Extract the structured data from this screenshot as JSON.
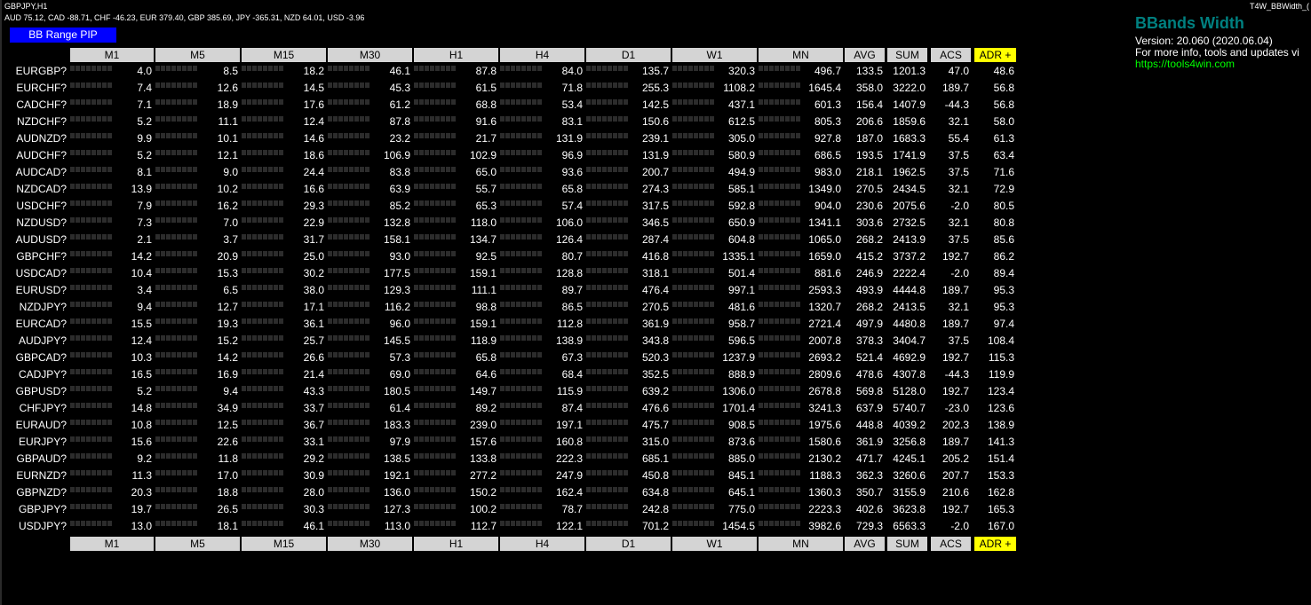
{
  "window": {
    "chart_title": "GBPJPY,H1",
    "currency_strength": "AUD 75.12, CAD -88.71, CHF -46.23, EUR 379.40, GBP 385.69, JPY -365.31, NZD 64.01, USD -3.96",
    "indicator_name": "T4W_BBWidth_(",
    "mode_button": "BB Range PIP"
  },
  "brand": {
    "title": "BBands Width",
    "version": "Version: 20.060 (2020.06.04)",
    "info": "For more info, tools and updates vi",
    "link": "https://tools4win.com"
  },
  "colors": {
    "background": "#000000",
    "header_bg": "#d4d4d4",
    "adr_header_bg": "#ffff00",
    "mode_button_bg": "#0000ff",
    "brand_title": "#008080",
    "link": "#00ff00",
    "bar_empty": "#2c2c2c"
  },
  "table": {
    "columns": [
      "M1",
      "M5",
      "M15",
      "M30",
      "H1",
      "H4",
      "D1",
      "W1",
      "MN",
      "AVG",
      "SUM",
      "ACS",
      "ADR +"
    ],
    "rows": [
      {
        "symbol": "EURGBP?",
        "values": [
          "4.0",
          "8.5",
          "18.2",
          "46.1",
          "87.8",
          "84.0",
          "135.7",
          "320.3",
          "496.7",
          "133.5",
          "1201.3",
          "47.0",
          "48.6"
        ]
      },
      {
        "symbol": "EURCHF?",
        "values": [
          "7.4",
          "12.6",
          "14.5",
          "45.3",
          "61.5",
          "71.8",
          "255.3",
          "1108.2",
          "1645.4",
          "358.0",
          "3222.0",
          "189.7",
          "56.8"
        ]
      },
      {
        "symbol": "CADCHF?",
        "values": [
          "7.1",
          "18.9",
          "17.6",
          "61.2",
          "68.8",
          "53.4",
          "142.5",
          "437.1",
          "601.3",
          "156.4",
          "1407.9",
          "-44.3",
          "56.8"
        ]
      },
      {
        "symbol": "NZDCHF?",
        "values": [
          "5.2",
          "11.1",
          "12.4",
          "87.8",
          "91.6",
          "83.1",
          "150.6",
          "612.5",
          "805.3",
          "206.6",
          "1859.6",
          "32.1",
          "58.0"
        ]
      },
      {
        "symbol": "AUDNZD?",
        "values": [
          "9.9",
          "10.1",
          "14.6",
          "23.2",
          "21.7",
          "131.9",
          "239.1",
          "305.0",
          "927.8",
          "187.0",
          "1683.3",
          "55.4",
          "61.3"
        ]
      },
      {
        "symbol": "AUDCHF?",
        "values": [
          "5.2",
          "12.1",
          "18.6",
          "106.9",
          "102.9",
          "96.9",
          "131.9",
          "580.9",
          "686.5",
          "193.5",
          "1741.9",
          "37.5",
          "63.4"
        ]
      },
      {
        "symbol": "AUDCAD?",
        "values": [
          "8.1",
          "9.0",
          "24.4",
          "83.8",
          "65.0",
          "93.6",
          "200.7",
          "494.9",
          "983.0",
          "218.1",
          "1962.5",
          "37.5",
          "71.6"
        ]
      },
      {
        "symbol": "NZDCAD?",
        "values": [
          "13.9",
          "10.2",
          "16.6",
          "63.9",
          "55.7",
          "65.8",
          "274.3",
          "585.1",
          "1349.0",
          "270.5",
          "2434.5",
          "32.1",
          "72.9"
        ]
      },
      {
        "symbol": "USDCHF?",
        "values": [
          "7.9",
          "16.2",
          "29.3",
          "85.2",
          "65.3",
          "57.4",
          "317.5",
          "592.8",
          "904.0",
          "230.6",
          "2075.6",
          "-2.0",
          "80.5"
        ]
      },
      {
        "symbol": "NZDUSD?",
        "values": [
          "7.3",
          "7.0",
          "22.9",
          "132.8",
          "118.0",
          "106.0",
          "346.5",
          "650.9",
          "1341.1",
          "303.6",
          "2732.5",
          "32.1",
          "80.8"
        ]
      },
      {
        "symbol": "AUDUSD?",
        "values": [
          "2.1",
          "3.7",
          "31.7",
          "158.1",
          "134.7",
          "126.4",
          "287.4",
          "604.8",
          "1065.0",
          "268.2",
          "2413.9",
          "37.5",
          "85.6"
        ]
      },
      {
        "symbol": "GBPCHF?",
        "values": [
          "14.2",
          "20.9",
          "25.0",
          "93.0",
          "92.5",
          "80.7",
          "416.8",
          "1335.1",
          "1659.0",
          "415.2",
          "3737.2",
          "192.7",
          "86.2"
        ]
      },
      {
        "symbol": "USDCAD?",
        "values": [
          "10.4",
          "15.3",
          "30.2",
          "177.5",
          "159.1",
          "128.8",
          "318.1",
          "501.4",
          "881.6",
          "246.9",
          "2222.4",
          "-2.0",
          "89.4"
        ]
      },
      {
        "symbol": "EURUSD?",
        "values": [
          "3.4",
          "6.5",
          "38.0",
          "129.3",
          "111.1",
          "89.7",
          "476.4",
          "997.1",
          "2593.3",
          "493.9",
          "4444.8",
          "189.7",
          "95.3"
        ]
      },
      {
        "symbol": "NZDJPY?",
        "values": [
          "9.4",
          "12.7",
          "17.1",
          "116.2",
          "98.8",
          "86.5",
          "270.5",
          "481.6",
          "1320.7",
          "268.2",
          "2413.5",
          "32.1",
          "95.3"
        ]
      },
      {
        "symbol": "EURCAD?",
        "values": [
          "15.5",
          "19.3",
          "36.1",
          "96.0",
          "159.1",
          "112.8",
          "361.9",
          "958.7",
          "2721.4",
          "497.9",
          "4480.8",
          "189.7",
          "97.4"
        ]
      },
      {
        "symbol": "AUDJPY?",
        "values": [
          "12.4",
          "15.2",
          "25.7",
          "145.5",
          "118.9",
          "138.9",
          "343.8",
          "596.5",
          "2007.8",
          "378.3",
          "3404.7",
          "37.5",
          "108.4"
        ]
      },
      {
        "symbol": "GBPCAD?",
        "values": [
          "10.3",
          "14.2",
          "26.6",
          "57.3",
          "65.8",
          "67.3",
          "520.3",
          "1237.9",
          "2693.2",
          "521.4",
          "4692.9",
          "192.7",
          "115.3"
        ]
      },
      {
        "symbol": "CADJPY?",
        "values": [
          "16.5",
          "16.9",
          "21.4",
          "69.0",
          "64.6",
          "68.4",
          "352.5",
          "888.9",
          "2809.6",
          "478.6",
          "4307.8",
          "-44.3",
          "119.9"
        ]
      },
      {
        "symbol": "GBPUSD?",
        "values": [
          "5.2",
          "9.4",
          "43.3",
          "180.5",
          "149.7",
          "115.9",
          "639.2",
          "1306.0",
          "2678.8",
          "569.8",
          "5128.0",
          "192.7",
          "123.4"
        ]
      },
      {
        "symbol": "CHFJPY?",
        "values": [
          "14.8",
          "34.9",
          "33.7",
          "61.4",
          "89.2",
          "87.4",
          "476.6",
          "1701.4",
          "3241.3",
          "637.9",
          "5740.7",
          "-23.0",
          "123.6"
        ]
      },
      {
        "symbol": "EURAUD?",
        "values": [
          "10.8",
          "12.5",
          "36.7",
          "183.3",
          "239.0",
          "197.1",
          "475.7",
          "908.5",
          "1975.6",
          "448.8",
          "4039.2",
          "202.3",
          "138.9"
        ]
      },
      {
        "symbol": "EURJPY?",
        "values": [
          "15.6",
          "22.6",
          "33.1",
          "97.9",
          "157.6",
          "160.8",
          "315.0",
          "873.6",
          "1580.6",
          "361.9",
          "3256.8",
          "189.7",
          "141.3"
        ]
      },
      {
        "symbol": "GBPAUD?",
        "values": [
          "9.2",
          "11.8",
          "29.2",
          "138.5",
          "133.8",
          "222.3",
          "685.1",
          "885.0",
          "2130.2",
          "471.7",
          "4245.1",
          "205.2",
          "151.4"
        ]
      },
      {
        "symbol": "EURNZD?",
        "values": [
          "11.3",
          "17.0",
          "30.9",
          "192.1",
          "277.2",
          "247.9",
          "450.8",
          "845.1",
          "1188.3",
          "362.3",
          "3260.6",
          "207.7",
          "153.3"
        ]
      },
      {
        "symbol": "GBPNZD?",
        "values": [
          "20.3",
          "18.8",
          "28.0",
          "136.0",
          "150.2",
          "162.4",
          "634.8",
          "645.1",
          "1360.3",
          "350.7",
          "3155.9",
          "210.6",
          "162.8"
        ]
      },
      {
        "symbol": "GBPJPY?",
        "values": [
          "19.7",
          "26.5",
          "30.3",
          "127.3",
          "100.2",
          "78.7",
          "242.8",
          "775.0",
          "2223.3",
          "402.6",
          "3623.8",
          "192.7",
          "165.3"
        ]
      },
      {
        "symbol": "USDJPY?",
        "values": [
          "13.0",
          "18.1",
          "46.1",
          "113.0",
          "112.7",
          "122.1",
          "701.2",
          "1454.5",
          "3982.6",
          "729.3",
          "6563.3",
          "-2.0",
          "167.0"
        ]
      }
    ]
  }
}
